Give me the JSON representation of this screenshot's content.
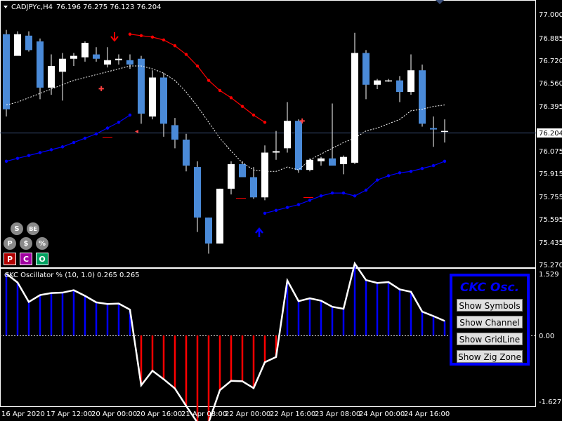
{
  "header": {
    "symbol": "CADJPYc,H4",
    "ohlc": "76.196 76.275 76.123 76.204"
  },
  "price_axis": {
    "labels": [
      "77.000",
      "76.885",
      "76.720",
      "76.560",
      "76.395",
      "76.235",
      "76.075",
      "75.915",
      "75.755",
      "75.595",
      "75.435",
      "75.270"
    ],
    "current_price": "76.204"
  },
  "indicator": {
    "title": "CKC Oscillator % (10, 1.0) 0.265 0.265",
    "axis_labels": [
      "1.529",
      "0.00",
      "-1.627"
    ]
  },
  "time_axis": {
    "labels": [
      "16 Apr 2020",
      "17 Apr 12:00",
      "20 Apr 00:00",
      "20 Apr 16:00",
      "21 Apr 08:00",
      "22 Apr 00:00",
      "22 Apr 16:00",
      "23 Apr 08:00",
      "24 Apr 00:00",
      "24 Apr 16:00"
    ]
  },
  "toolbar": {
    "s": "S",
    "be": "BE",
    "p": "P",
    "dollar": "$",
    "percent": "%",
    "p2": "P",
    "c": "C",
    "o": "O"
  },
  "panel": {
    "title": "CKC Osc.",
    "show_symbols": "Show Symbols",
    "show_channel": "Show Channel",
    "show_gridline": "Show GridLine",
    "show_zigzone": "Show Zig Zone"
  },
  "colors": {
    "bull": "#ffffff",
    "bear": "#4a8ad8",
    "upper_channel": "#ff0000",
    "lower_channel": "#0000ff",
    "panel_border": "#0000ff",
    "osc_pos": "#0000ff",
    "osc_neg": "#ff0000"
  },
  "chart_data": {
    "type": "candlestick",
    "symbol": "CADJPYc",
    "timeframe": "H4",
    "ylim": [
      75.27,
      77.0
    ],
    "candles": [
      {
        "o": 76.87,
        "h": 76.9,
        "l": 76.3,
        "c": 76.35
      },
      {
        "o": 76.72,
        "h": 76.89,
        "l": 76.73,
        "c": 76.87
      },
      {
        "o": 76.86,
        "h": 76.89,
        "l": 76.75,
        "c": 76.76
      },
      {
        "o": 76.82,
        "h": 76.84,
        "l": 76.42,
        "c": 76.5
      },
      {
        "o": 76.5,
        "h": 76.73,
        "l": 76.45,
        "c": 76.65
      },
      {
        "o": 76.61,
        "h": 76.74,
        "l": 76.41,
        "c": 76.7
      },
      {
        "o": 76.7,
        "h": 76.74,
        "l": 76.65,
        "c": 76.72
      },
      {
        "o": 76.71,
        "h": 76.82,
        "l": 76.68,
        "c": 76.81
      },
      {
        "o": 76.73,
        "h": 76.78,
        "l": 76.68,
        "c": 76.7
      },
      {
        "o": 76.66,
        "h": 76.78,
        "l": 76.64,
        "c": 76.69
      },
      {
        "o": 76.69,
        "h": 76.73,
        "l": 76.66,
        "c": 76.7
      },
      {
        "o": 76.69,
        "h": 76.73,
        "l": 76.63,
        "c": 76.66
      },
      {
        "o": 76.7,
        "h": 76.72,
        "l": 76.25,
        "c": 76.32
      },
      {
        "o": 76.3,
        "h": 76.62,
        "l": 76.28,
        "c": 76.57
      },
      {
        "o": 76.57,
        "h": 76.6,
        "l": 76.16,
        "c": 76.25
      },
      {
        "o": 76.24,
        "h": 76.29,
        "l": 76.08,
        "c": 76.14
      },
      {
        "o": 76.14,
        "h": 76.18,
        "l": 75.92,
        "c": 75.96
      },
      {
        "o": 75.95,
        "h": 75.99,
        "l": 75.5,
        "c": 75.6
      },
      {
        "o": 75.6,
        "h": 75.6,
        "l": 75.35,
        "c": 75.42
      },
      {
        "o": 75.42,
        "h": 75.8,
        "l": 75.42,
        "c": 75.8
      },
      {
        "o": 75.8,
        "h": 75.99,
        "l": 75.76,
        "c": 75.97
      },
      {
        "o": 75.97,
        "h": 75.99,
        "l": 75.9,
        "c": 75.88
      },
      {
        "o": 75.88,
        "h": 75.95,
        "l": 75.73,
        "c": 75.74
      },
      {
        "o": 75.74,
        "h": 76.1,
        "l": 75.72,
        "c": 76.05
      },
      {
        "o": 76.05,
        "h": 76.2,
        "l": 76.0,
        "c": 76.06
      },
      {
        "o": 76.08,
        "h": 76.4,
        "l": 76.05,
        "c": 76.27
      },
      {
        "o": 76.27,
        "h": 76.28,
        "l": 75.91,
        "c": 75.93
      },
      {
        "o": 75.93,
        "h": 76.01,
        "l": 75.92,
        "c": 76.0
      },
      {
        "o": 75.99,
        "h": 76.02,
        "l": 75.96,
        "c": 76.01
      },
      {
        "o": 76.01,
        "h": 76.39,
        "l": 75.96,
        "c": 75.96
      },
      {
        "o": 75.97,
        "h": 76.03,
        "l": 75.9,
        "c": 76.02
      },
      {
        "o": 75.98,
        "h": 76.88,
        "l": 75.97,
        "c": 76.74
      },
      {
        "o": 76.74,
        "h": 76.76,
        "l": 76.42,
        "c": 76.52
      },
      {
        "o": 76.52,
        "h": 76.56,
        "l": 76.49,
        "c": 76.55
      },
      {
        "o": 76.55,
        "h": 76.56,
        "l": 76.54,
        "c": 76.55
      },
      {
        "o": 76.55,
        "h": 76.58,
        "l": 76.4,
        "c": 76.47
      },
      {
        "o": 76.47,
        "h": 76.73,
        "l": 76.45,
        "c": 76.62
      },
      {
        "o": 76.62,
        "h": 76.66,
        "l": 76.23,
        "c": 76.25
      },
      {
        "o": 76.22,
        "h": 76.3,
        "l": 76.09,
        "c": 76.21
      },
      {
        "o": 76.2,
        "h": 76.28,
        "l": 76.12,
        "c": 76.2
      }
    ],
    "upper_channel": [
      null,
      null,
      null,
      null,
      null,
      null,
      null,
      null,
      null,
      null,
      null,
      76.87,
      76.86,
      76.85,
      76.83,
      76.79,
      76.73,
      76.65,
      76.55,
      76.48,
      76.43,
      76.37,
      76.31,
      76.26,
      null,
      null,
      null,
      null,
      null,
      null,
      null,
      null,
      null,
      null,
      null,
      null,
      null,
      null,
      null,
      null
    ],
    "lower_channel": [
      75.99,
      76.01,
      76.03,
      76.05,
      76.07,
      76.09,
      76.12,
      76.15,
      76.18,
      76.22,
      76.26,
      76.31,
      null,
      null,
      null,
      null,
      null,
      null,
      null,
      null,
      null,
      null,
      null,
      75.63,
      75.65,
      75.67,
      75.69,
      75.72,
      75.75,
      75.77,
      75.77,
      75.75,
      75.79,
      75.86,
      75.89,
      75.91,
      75.92,
      75.94,
      75.96,
      75.99
    ],
    "midline": [
      76.38,
      76.4,
      76.43,
      76.46,
      76.49,
      76.52,
      76.55,
      76.57,
      76.59,
      76.61,
      76.63,
      76.65,
      76.65,
      76.63,
      76.6,
      76.55,
      76.47,
      76.37,
      76.26,
      76.15,
      76.06,
      75.98,
      75.93,
      75.92,
      75.92,
      75.95,
      75.93,
      76.0,
      76.04,
      76.08,
      76.12,
      76.15,
      76.2,
      76.22,
      76.25,
      76.28,
      76.34,
      76.35,
      76.37,
      76.38
    ],
    "oscillator": [
      1.529,
      1.31,
      0.83,
      1.0,
      1.05,
      1.06,
      1.12,
      0.98,
      0.82,
      0.78,
      0.79,
      0.64,
      -1.23,
      -0.87,
      -1.08,
      -1.31,
      -1.74,
      -2.15,
      -2.15,
      -1.35,
      -1.12,
      -1.13,
      -1.3,
      -0.66,
      -0.53,
      1.36,
      0.85,
      0.92,
      0.86,
      0.71,
      0.66,
      1.78,
      1.37,
      1.3,
      1.32,
      1.14,
      1.08,
      0.59,
      0.48,
      0.36
    ],
    "osc_ylim": [
      -1.627,
      1.529
    ]
  }
}
